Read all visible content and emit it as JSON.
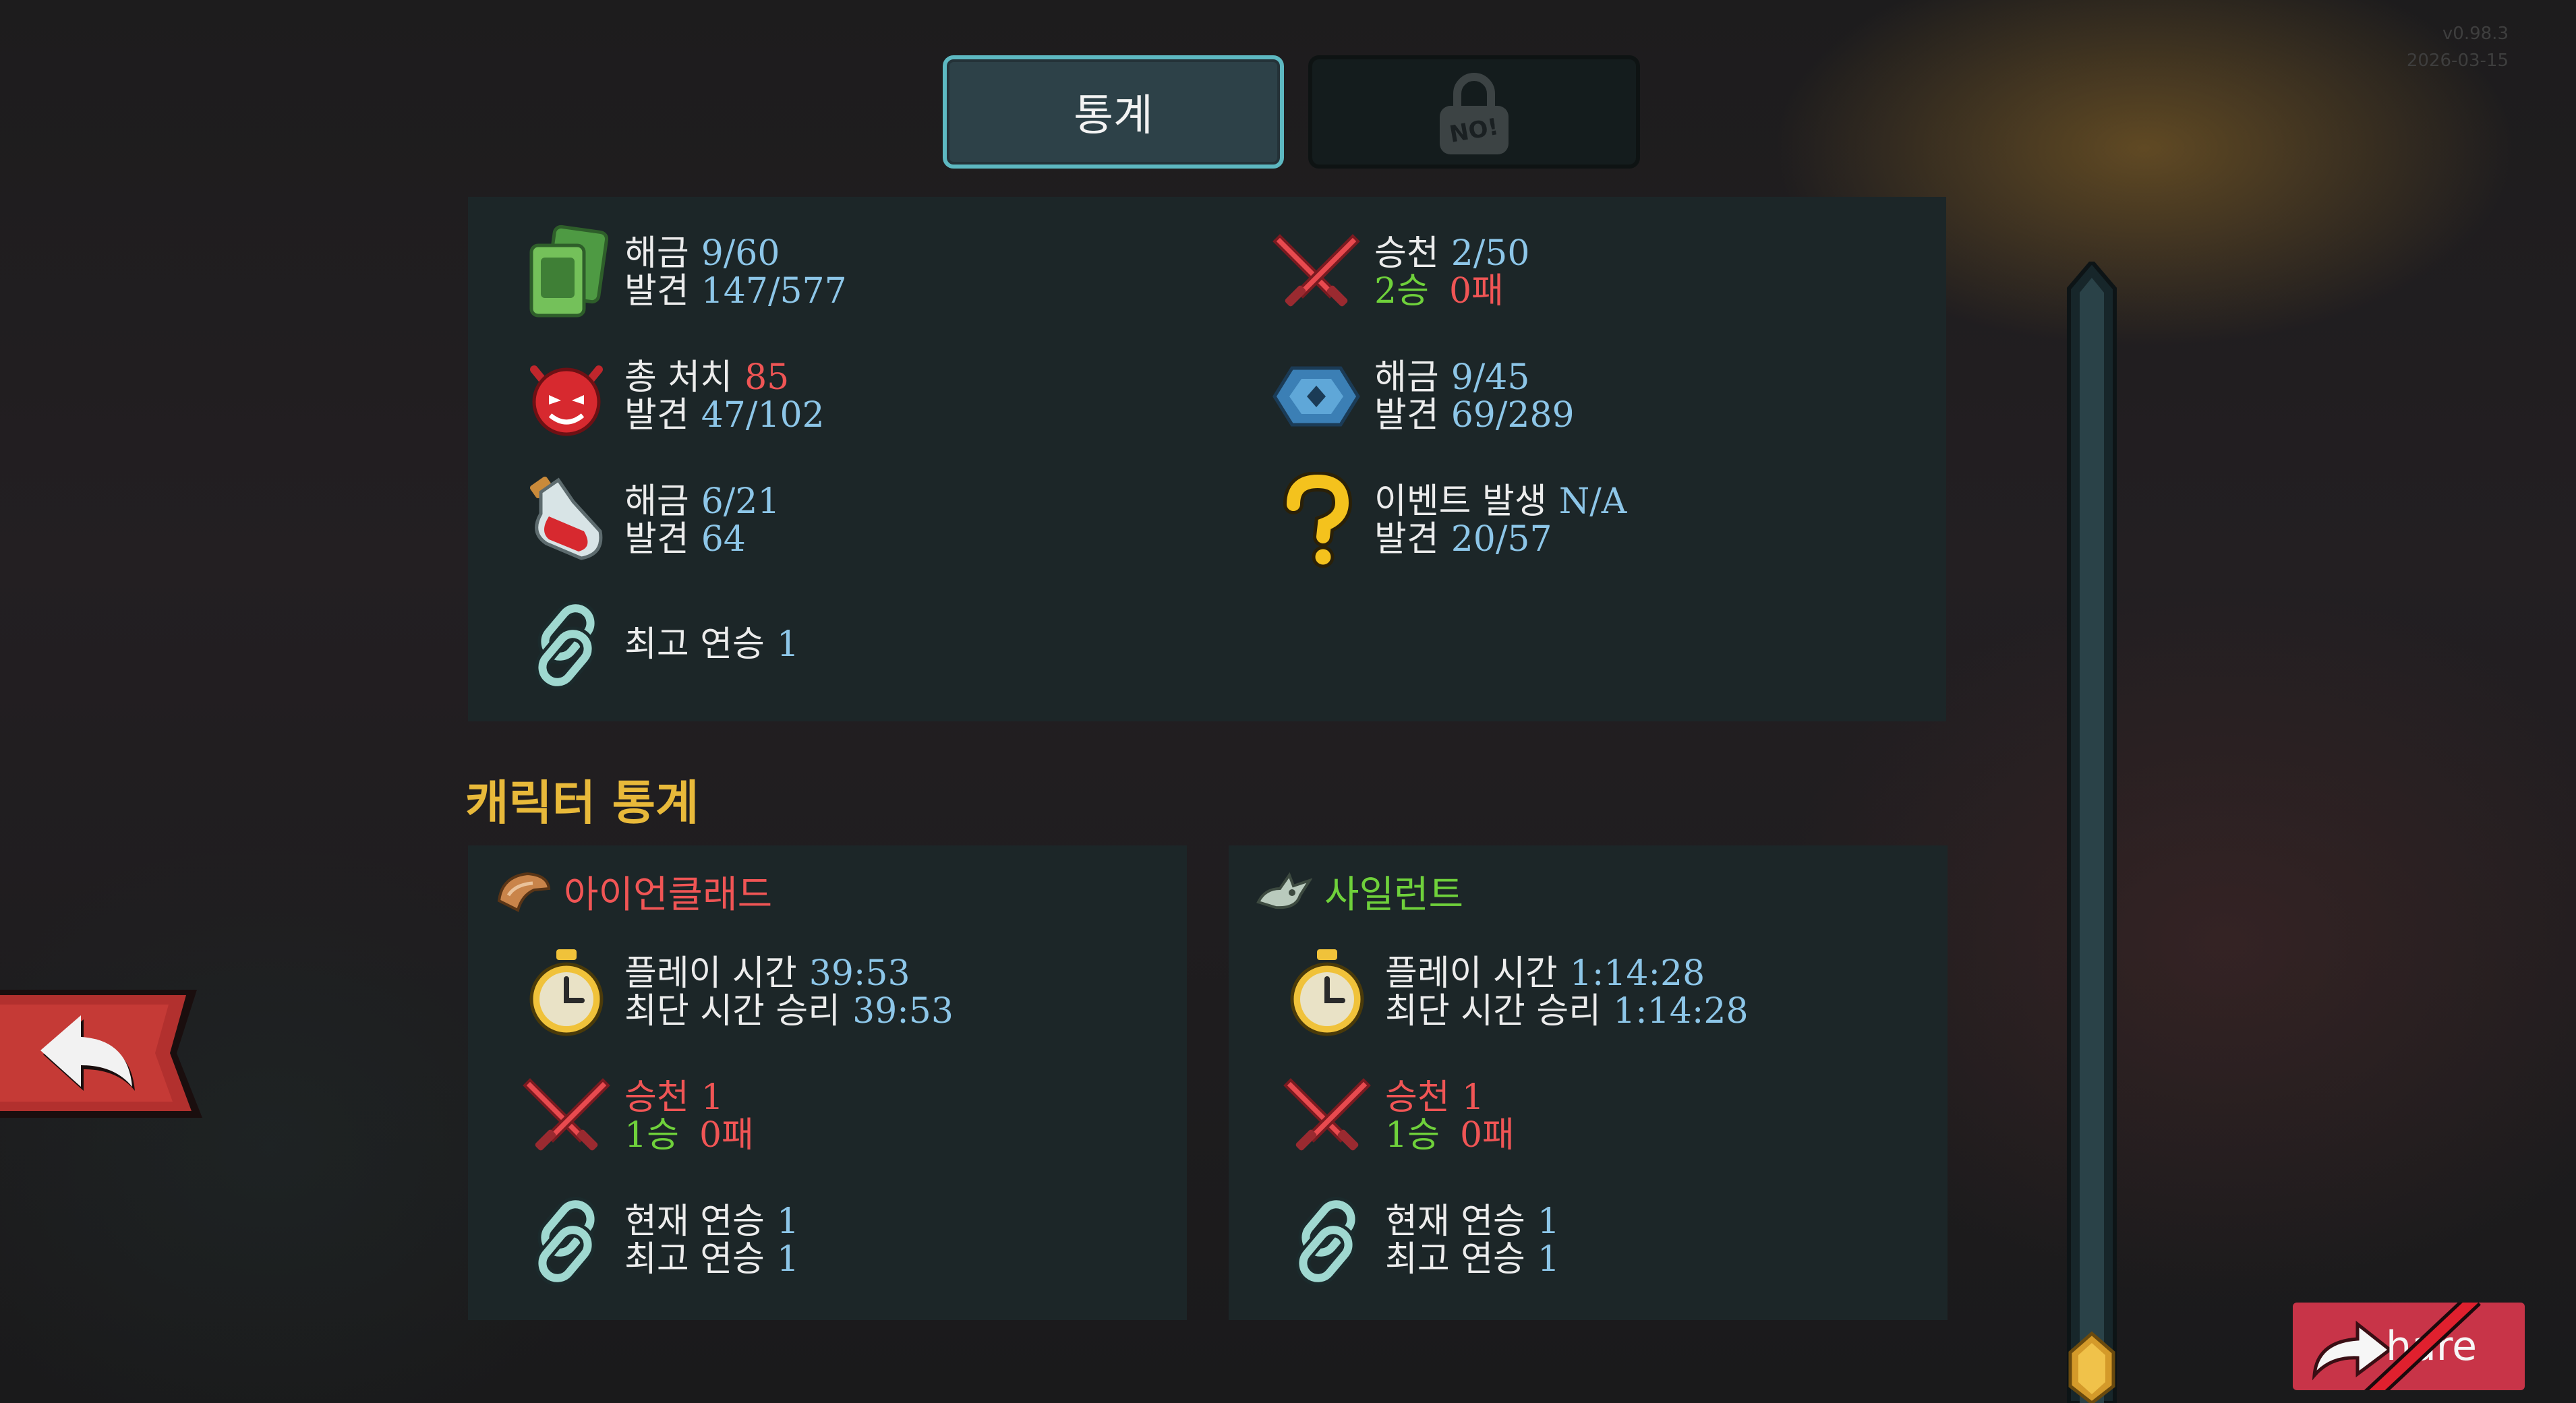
{
  "version": {
    "number": "v0.98.3",
    "date": "2026-03-15"
  },
  "tabs": {
    "stats_label": "통계",
    "locked_badge": "NO!"
  },
  "general": {
    "cards": {
      "unlock_label": "해금",
      "unlock_value": "9/60",
      "found_label": "발견",
      "found_value": "147/577"
    },
    "ascension": {
      "label": "승천",
      "value": "2/50",
      "wins": "2승",
      "losses": "0패"
    },
    "monsters": {
      "kills_label": "총 처치",
      "kills_value": "85",
      "found_label": "발견",
      "found_value": "47/102"
    },
    "relics": {
      "unlock_label": "해금",
      "unlock_value": "9/45",
      "found_label": "발견",
      "found_value": "69/289"
    },
    "potions": {
      "unlock_label": "해금",
      "unlock_value": "6/21",
      "found_label": "발견",
      "found_value": "64"
    },
    "events": {
      "label": "이벤트 발생",
      "value": "N/A",
      "found_label": "발견",
      "found_value": "20/57"
    },
    "streak": {
      "label": "최고 연승",
      "value": "1"
    }
  },
  "character_section_title": "캐릭터 통계",
  "characters": [
    {
      "name": "아이언클래드",
      "name_color": "#f05555",
      "playtime_label": "플레이 시간",
      "playtime_value": "39:53",
      "fastest_label": "최단 시간 승리",
      "fastest_value": "39:53",
      "ascension_label": "승천",
      "ascension_value": "1",
      "wins": "1승",
      "losses": "0패",
      "current_streak_label": "현재 연승",
      "current_streak_value": "1",
      "best_streak_label": "최고 연승",
      "best_streak_value": "1"
    },
    {
      "name": "사일런트",
      "name_color": "#6fd13b",
      "playtime_label": "플레이 시간",
      "playtime_value": "1:14:28",
      "fastest_label": "최단 시간 승리",
      "fastest_value": "1:14:28",
      "ascension_label": "승천",
      "ascension_value": "1",
      "wins": "1승",
      "losses": "0패",
      "current_streak_label": "현재 연승",
      "current_streak_value": "1",
      "best_streak_label": "최고 연승",
      "best_streak_value": "1"
    }
  ],
  "share": {
    "label": "Share",
    "visible_label": "hare"
  },
  "colors": {
    "accent_blue": "#8dc6e8",
    "red": "#f05555",
    "green": "#6fd13b",
    "gold": "#e8b93a",
    "tab_border": "#5db8c1",
    "share_bg": "#c83448"
  },
  "icons": {
    "cards": "green-card-stack-icon",
    "ascension": "crossed-red-swords-icon",
    "monsters": "red-demon-face-icon",
    "relics": "blue-relic-icon",
    "potions": "red-potion-icon",
    "events": "yellow-question-mark-icon",
    "streak": "chain-link-icon",
    "ironclad": "ironclad-helmet-icon",
    "silent": "silent-crest-icon",
    "stopwatch": "stopwatch-icon",
    "back": "back-arrow-icon",
    "share": "share-arrow-icon",
    "lock": "lock-icon"
  }
}
